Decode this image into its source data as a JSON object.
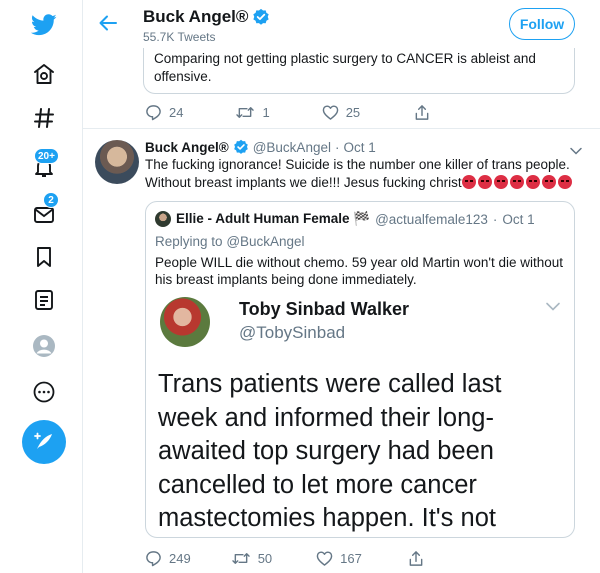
{
  "header": {
    "name": "Buck Angel®",
    "tweet_count": "55.7K Tweets",
    "follow_label": "Follow"
  },
  "sidebar": {
    "items": [
      {
        "icon": "twitter-bird-icon"
      },
      {
        "icon": "home-icon"
      },
      {
        "icon": "hashtag-icon"
      },
      {
        "icon": "bell-icon",
        "badge": "20+"
      },
      {
        "icon": "mail-icon",
        "badge": "2"
      },
      {
        "icon": "bookmark-icon"
      },
      {
        "icon": "list-icon"
      },
      {
        "icon": "profile-icon"
      },
      {
        "icon": "more-icon"
      },
      {
        "icon": "compose-icon"
      }
    ]
  },
  "prev_tweet": {
    "quote_text": "Comparing not getting plastic surgery to CANCER is ableist and offensive.",
    "reply_count": "24",
    "retweet_count": "1",
    "like_count": "25"
  },
  "tweet": {
    "name": "Buck Angel®",
    "handle": "@BuckAngel",
    "sep": "·",
    "date": "Oct 1",
    "text": "The fucking ignorance! Suicide is the number one killer of trans people. Without breast implants we die!!! Jesus fucking christ",
    "emoji_count": 7,
    "reply_count": "249",
    "retweet_count": "50",
    "like_count": "167"
  },
  "quoted": {
    "name": "Ellie - Adult Human Female 🏁",
    "handle": "@actualfemale123",
    "sep": "·",
    "date": "Oct 1",
    "replying_label": "Replying to",
    "replying_handle": "@BuckAngel",
    "text": "People WILL die without chemo. 59 year old Martin won't die without his breast implants being done immediately."
  },
  "embedded": {
    "name": "Toby Sinbad Walker",
    "handle": "@TobySinbad",
    "text": "Trans patients were called last week and informed their long-awaited top surgery had been cancelled to let more cancer mastectomies happen. It's not"
  },
  "colors": {
    "accent": "#1da1f2",
    "text": "#14171a",
    "muted": "#657786",
    "border": "#e6ecf0"
  }
}
